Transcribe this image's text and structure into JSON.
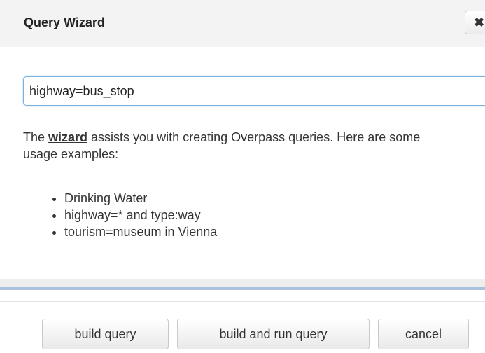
{
  "dialog": {
    "title": "Query Wizard",
    "close_icon": "close-icon"
  },
  "search": {
    "value": "highway=bus_stop"
  },
  "description": {
    "prefix": "The ",
    "link_text": "wizard",
    "suffix": " assists you with creating Overpass queries. Here are some usage examples:"
  },
  "examples": [
    "Drinking Water",
    "highway=* and type:way",
    "tourism=museum in Vienna"
  ],
  "buttons": {
    "build": "build query",
    "build_run": "build and run query",
    "cancel": "cancel"
  },
  "colors": {
    "header_bg": "#f3f3f3",
    "input_border": "#7ab0dd",
    "footer_rule": "#a9c1db"
  }
}
